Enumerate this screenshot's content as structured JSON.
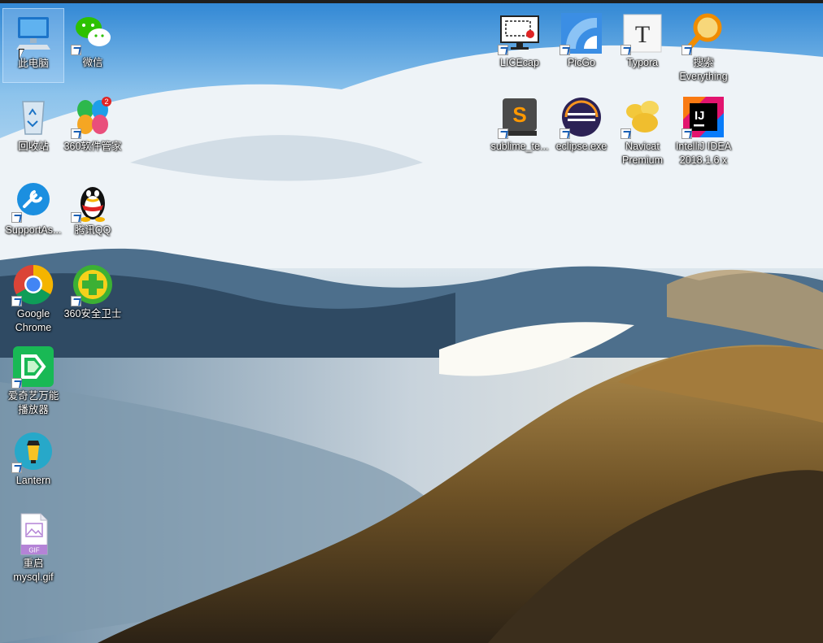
{
  "desktop": {
    "icons": [
      {
        "label": "此电脑",
        "icon": "this-pc-icon"
      },
      {
        "label": "微信",
        "icon": "wechat-icon"
      },
      {
        "label": "回收站",
        "icon": "recycle-bin-icon"
      },
      {
        "label": "360软件管家",
        "icon": "360-software-manager-icon"
      },
      {
        "label": "SupportAs...",
        "icon": "support-assistant-icon"
      },
      {
        "label": "腾讯QQ",
        "icon": "qq-penguin-icon"
      },
      {
        "label": "Google\nChrome",
        "icon": "chrome-icon"
      },
      {
        "label": "360安全卫士",
        "icon": "360-security-icon"
      },
      {
        "label": "爱奇艺万能\n播放器",
        "icon": "iqiyi-player-icon"
      },
      {
        "label": "Lantern",
        "icon": "lantern-icon"
      },
      {
        "label": "重启\nmysql.gif",
        "icon": "gif-file-icon"
      },
      {
        "label": "LICEcap",
        "icon": "licecap-icon"
      },
      {
        "label": "PicGo",
        "icon": "picgo-icon"
      },
      {
        "label": "Typora",
        "icon": "typora-icon"
      },
      {
        "label": "搜索\nEverything",
        "icon": "everything-search-icon"
      },
      {
        "label": "sublime_te...",
        "icon": "sublime-text-icon"
      },
      {
        "label": "eclipse.exe",
        "icon": "eclipse-icon"
      },
      {
        "label": "Navicat\nPremium",
        "icon": "navicat-icon"
      },
      {
        "label": "IntelliJ IDEA\n2018.1.6 x",
        "icon": "intellij-idea-icon"
      }
    ],
    "badges": {
      "software_manager_count": "2",
      "gif_tag": "GIF"
    },
    "colors": {
      "sky": "#3a8fd6",
      "cloud": "#eef3f7",
      "mountain_dark": "#3b2e1c",
      "mountain_gold": "#a07a3a"
    }
  }
}
